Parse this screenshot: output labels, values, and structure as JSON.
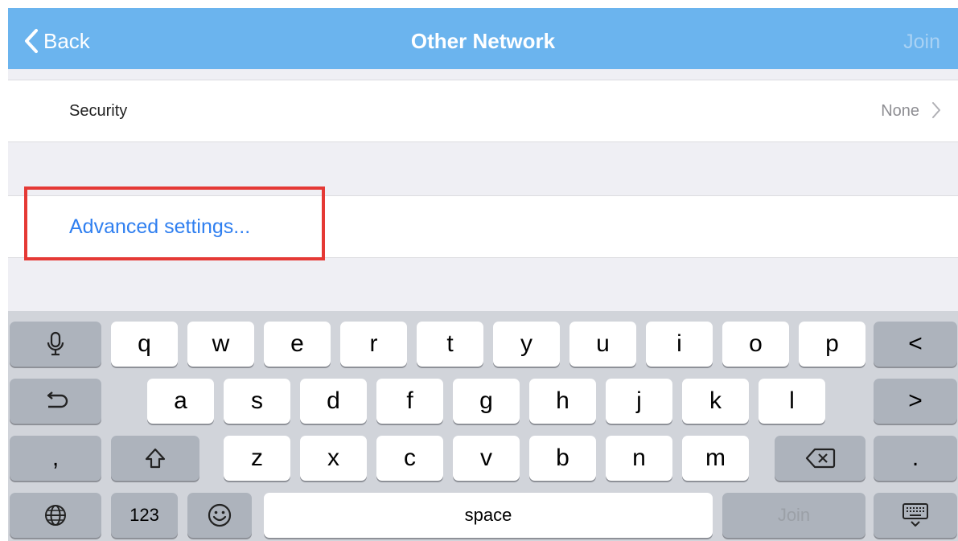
{
  "nav": {
    "back_label": "Back",
    "title": "Other Network",
    "join_label": "Join"
  },
  "security_row": {
    "label": "Security",
    "value": "None"
  },
  "advanced_row": {
    "label": "Advanced settings..."
  },
  "keyboard": {
    "row1": [
      "q",
      "w",
      "e",
      "r",
      "t",
      "y",
      "u",
      "i",
      "o",
      "p"
    ],
    "row2": [
      "a",
      "s",
      "d",
      "f",
      "g",
      "h",
      "j",
      "k",
      "l"
    ],
    "row3": [
      "z",
      "x",
      "c",
      "v",
      "b",
      "n",
      "m"
    ],
    "comma_key": ",",
    "period_key": ".",
    "numbers_key": "123",
    "space_key": "space",
    "join_key": "Join",
    "arrow_left": "<",
    "arrow_right": ">"
  },
  "colors": {
    "navbar": "#6bb4ee",
    "link": "#2f7ff0",
    "highlight": "#e53935",
    "keyboard_bg": "#d1d4da"
  }
}
